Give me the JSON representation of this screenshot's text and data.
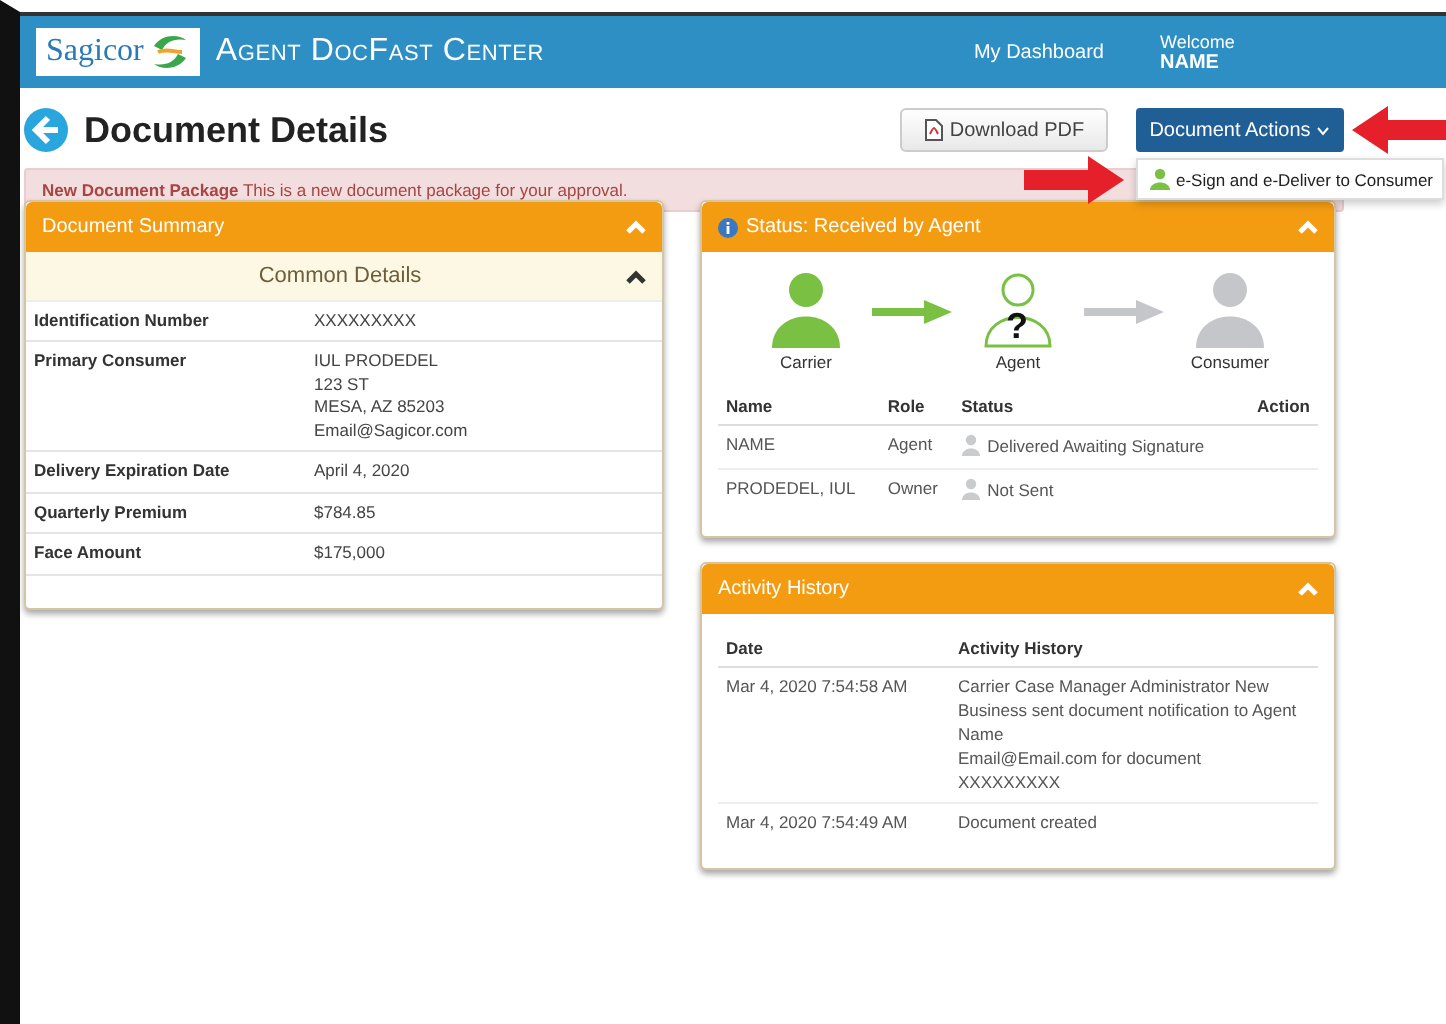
{
  "header": {
    "logo": "Sagicor",
    "title": "Agent DocFast Center",
    "nav_link": "My Dashboard",
    "welcome": "Welcome",
    "user": "NAME"
  },
  "page": {
    "title": "Document Details",
    "download_button": "Download PDF",
    "actions_button": "Document Actions",
    "actions_menu_open": true,
    "actions_menu": [
      "e-Sign and e-Deliver to Consumer"
    ]
  },
  "alert": {
    "title": "New Document Package",
    "message": "This is a new document package for your approval."
  },
  "summary": {
    "title": "Document Summary",
    "section": "Common Details",
    "rows": [
      {
        "label": "Identification Number",
        "lines": [
          "XXXXXXXXX"
        ]
      },
      {
        "label": "Primary Consumer",
        "lines": [
          "IUL PRODEDEL",
          "123 ST",
          "MESA, AZ 85203",
          "Email@Sagicor.com"
        ]
      },
      {
        "label": "Delivery Expiration Date",
        "lines": [
          "April 4, 2020"
        ]
      },
      {
        "label": "Quarterly Premium",
        "lines": [
          "$784.85"
        ]
      },
      {
        "label": "Face Amount",
        "lines": [
          "$175,000"
        ]
      }
    ]
  },
  "status": {
    "title": "Status: Received by Agent",
    "stages": [
      {
        "label": "Carrier",
        "reached": true,
        "current": false
      },
      {
        "label": "Agent",
        "reached": true,
        "current": true,
        "symbol": "?"
      },
      {
        "label": "Consumer",
        "reached": false,
        "current": false
      }
    ],
    "columns": [
      "Name",
      "Role",
      "Status",
      "Action"
    ],
    "rows": [
      {
        "name": "NAME",
        "role": "Agent",
        "status": "Delivered Awaiting Signature"
      },
      {
        "name": "PRODEDEL, IUL",
        "role": "Owner",
        "status": "Not Sent"
      }
    ]
  },
  "activity": {
    "title": "Activity History",
    "columns": [
      "Date",
      "Activity History"
    ],
    "rows": [
      {
        "date": "Mar 4, 2020 7:54:58 AM",
        "lines": [
          "Carrier Case Manager Administrator New Business sent document notification to Agent",
          "Name",
          "Email@Email.com for document",
          "XXXXXXXXX"
        ]
      },
      {
        "date": "Mar 4, 2020 7:54:49 AM",
        "lines": [
          "Document created"
        ]
      }
    ]
  }
}
